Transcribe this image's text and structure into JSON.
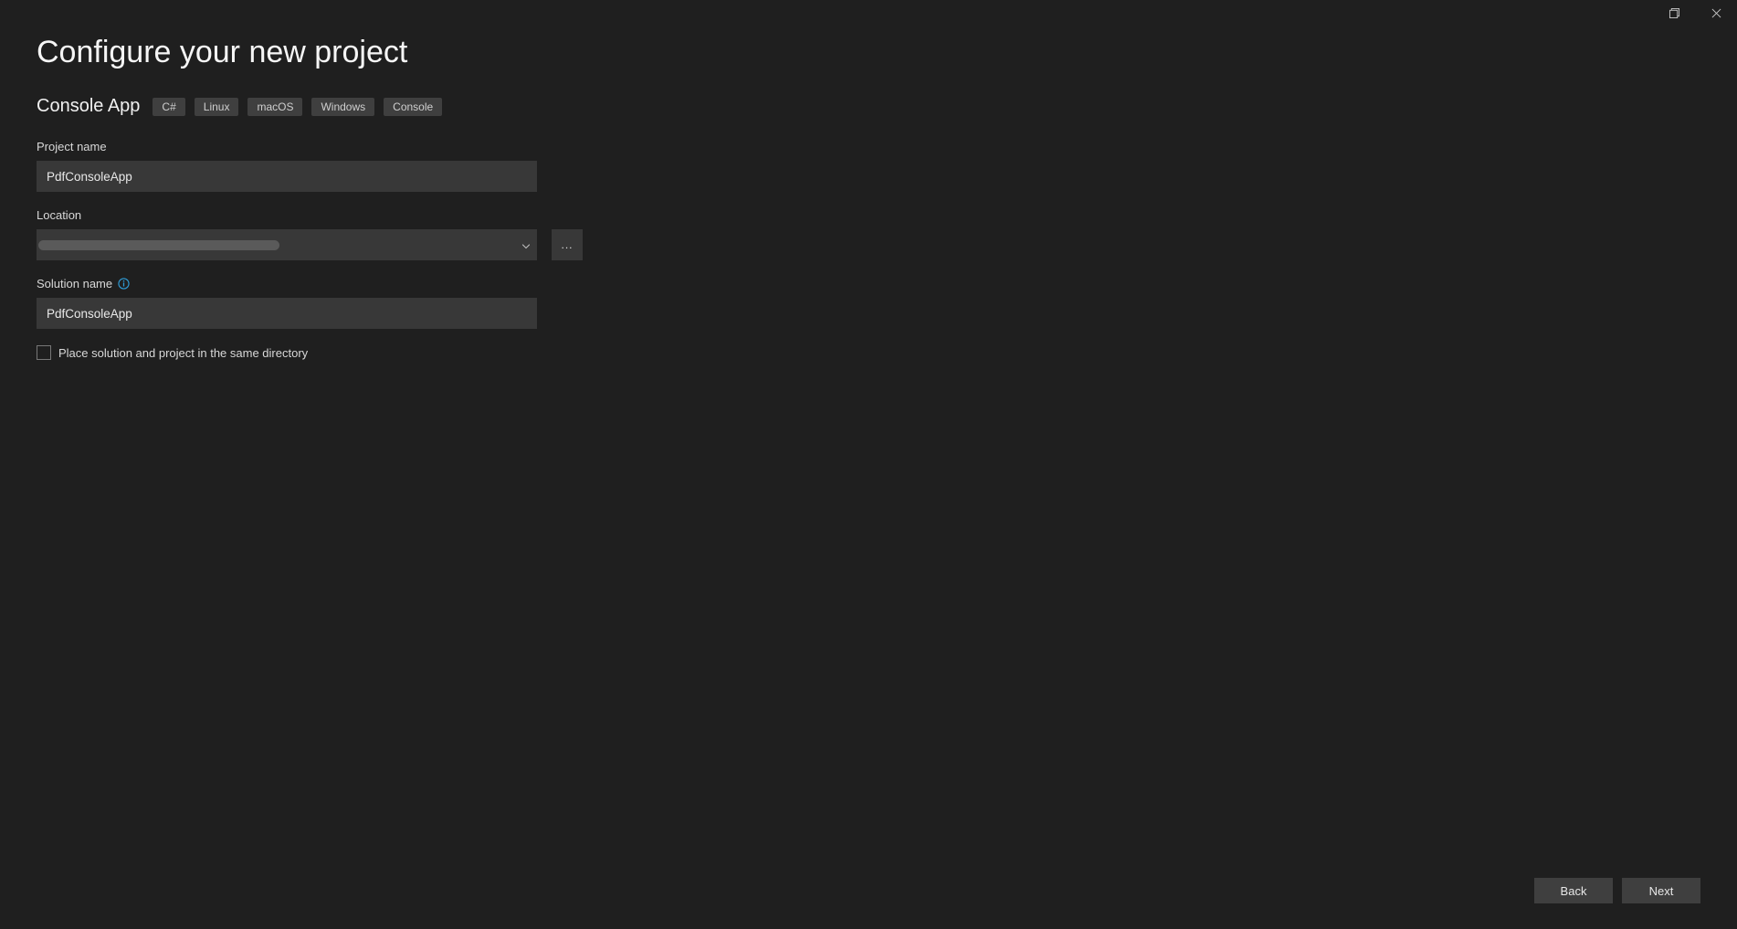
{
  "window": {
    "maximize_icon": "maximize",
    "close_icon": "close"
  },
  "header": {
    "title": "Configure your new project",
    "template_name": "Console App",
    "tags": [
      "C#",
      "Linux",
      "macOS",
      "Windows",
      "Console"
    ]
  },
  "fields": {
    "project_name": {
      "label": "Project name",
      "value": "PdfConsoleApp"
    },
    "location": {
      "label": "Location",
      "value": "",
      "browse_label": "..."
    },
    "solution_name": {
      "label": "Solution name",
      "value": "PdfConsoleApp"
    },
    "same_dir_checkbox": {
      "label": "Place solution and project in the same directory",
      "checked": false
    }
  },
  "footer": {
    "back": "Back",
    "next": "Next"
  }
}
